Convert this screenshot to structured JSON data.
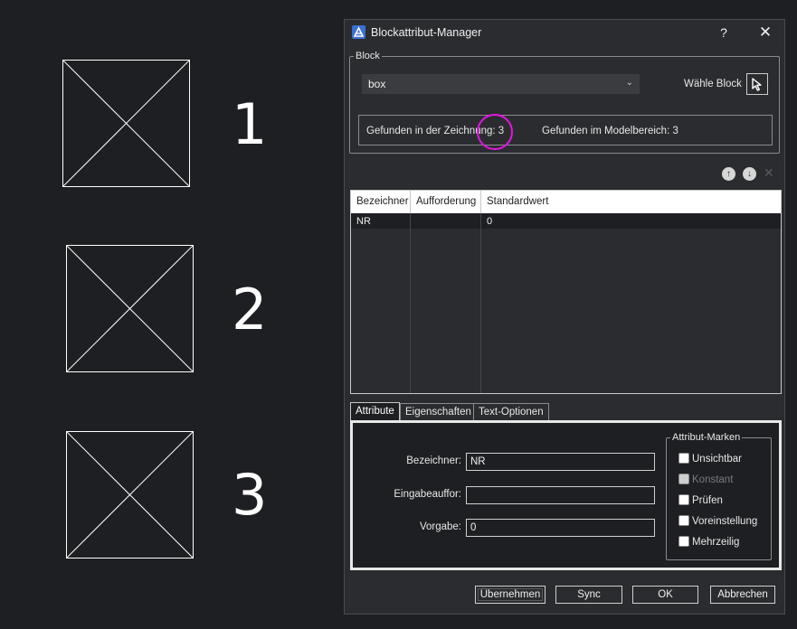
{
  "canvas": {
    "labels": [
      "1",
      "2",
      "3"
    ]
  },
  "dialog": {
    "title": "Blockattribut-Manager",
    "help": "?",
    "close": "✕",
    "block_group": {
      "legend": "Block",
      "selected_block": "box",
      "pick_label": "Wähle Block",
      "found_in_drawing": "Gefunden in der Zeichnung: 3",
      "found_in_model": "Gefunden im Modelbereich: 3"
    },
    "table": {
      "headers": [
        "Bezeichner",
        "Aufforderung",
        "Standardwert"
      ],
      "rows": [
        {
          "tag": "NR",
          "prompt": "",
          "default": "0"
        }
      ]
    },
    "tabs": [
      "Attribute",
      "Eigenschaften",
      "Text-Optionen"
    ],
    "attribute_tab": {
      "tag_label": "Bezeichner:",
      "tag_value": "NR",
      "prompt_label": "Eingabeauffor:",
      "prompt_value": "",
      "default_label": "Vorgabe:",
      "default_value": "0",
      "marks_legend": "Attribut-Marken",
      "marks": [
        {
          "label": "Unsichtbar",
          "checked": false,
          "enabled": true
        },
        {
          "label": "Konstant",
          "checked": false,
          "enabled": false
        },
        {
          "label": "Prüfen",
          "checked": false,
          "enabled": true
        },
        {
          "label": "Voreinstellung",
          "checked": false,
          "enabled": true
        },
        {
          "label": "Mehrzeilig",
          "checked": false,
          "enabled": true
        }
      ]
    },
    "buttons": {
      "apply": "Übernehmen",
      "sync": "Sync",
      "ok": "OK",
      "cancel": "Abbrechen"
    }
  }
}
